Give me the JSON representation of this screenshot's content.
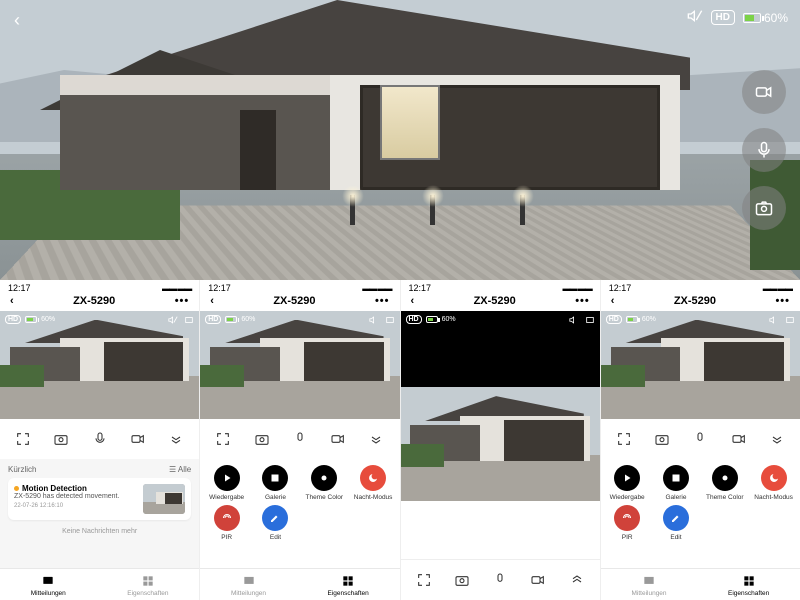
{
  "hero": {
    "hd_label": "HD",
    "battery_pct": "60%"
  },
  "status_time": "12:17",
  "device_name": "ZX-5290",
  "feed": {
    "hd": "HD",
    "battery": "60%"
  },
  "motion": {
    "recent_label": "Kürzlich",
    "all_label": "Alle",
    "title": "Motion Detection",
    "body": "ZX-5290 has detected movement.",
    "timestamp": "22-07-26 12:16:10",
    "no_more": "Keine Nachrichten mehr"
  },
  "grid": {
    "playback": "Wiedergabe",
    "gallery": "Galerie",
    "theme": "Theme Color",
    "night": "Nacht-Modus",
    "pir": "PIR",
    "edit": "Edit"
  },
  "tabs": {
    "messages": "Mitteilungen",
    "properties": "Eigenschaften"
  }
}
